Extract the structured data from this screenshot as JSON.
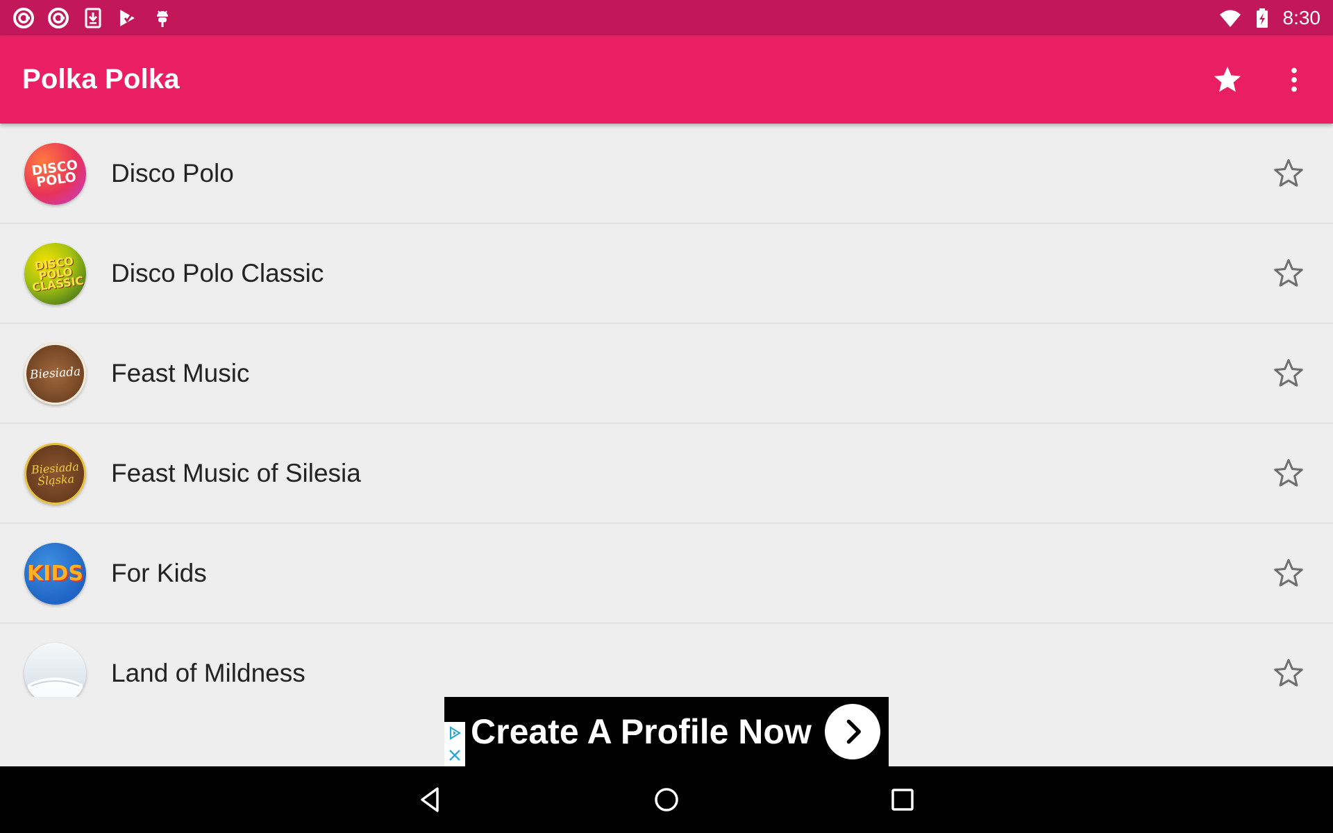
{
  "status_bar": {
    "time": "8:30",
    "left_icons": [
      "swirl-app-icon",
      "swirl-app-icon",
      "download-icon",
      "play-store-icon",
      "android-debug-icon"
    ],
    "right_icons": [
      "wifi-icon",
      "battery-charging-icon"
    ]
  },
  "app_bar": {
    "title": "Polka Polka",
    "actions": [
      "star-filled-icon",
      "more-vert-icon"
    ]
  },
  "stations": [
    {
      "label": "Disco Polo",
      "avatar_text": "DISCO POLO",
      "favorite": false
    },
    {
      "label": "Disco Polo Classic",
      "avatar_text": "DISCO POLO CLASSIC",
      "favorite": false
    },
    {
      "label": "Feast Music",
      "avatar_text": "Biesiada",
      "favorite": false
    },
    {
      "label": "Feast Music of Silesia",
      "avatar_text": "Biesiada Śląska",
      "favorite": false
    },
    {
      "label": "For Kids",
      "avatar_text": "KIDS",
      "favorite": false
    },
    {
      "label": "Land of Mildness",
      "avatar_text": "",
      "favorite": false
    }
  ],
  "ad": {
    "text": "Create A Profile Now"
  },
  "nav_bar": [
    "back-icon",
    "home-icon",
    "recents-icon"
  ],
  "colors": {
    "status_bar": "#c2185b",
    "app_bar": "#e91e63",
    "background": "#eeeeee"
  }
}
